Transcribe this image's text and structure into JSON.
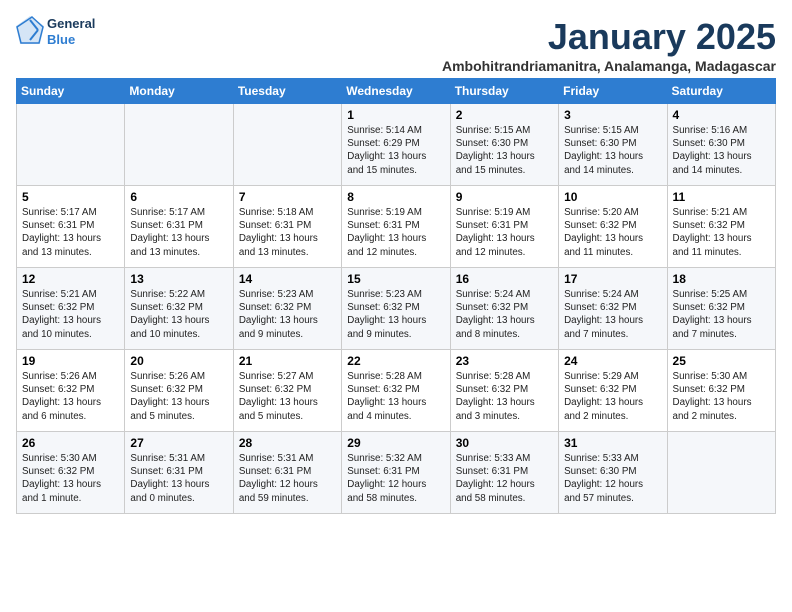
{
  "header": {
    "logo_line1": "General",
    "logo_line2": "Blue",
    "month_year": "January 2025",
    "location": "Ambohitrandriamanitra, Analamanga, Madagascar"
  },
  "days_of_week": [
    "Sunday",
    "Monday",
    "Tuesday",
    "Wednesday",
    "Thursday",
    "Friday",
    "Saturday"
  ],
  "weeks": [
    [
      {
        "day": "",
        "info": ""
      },
      {
        "day": "",
        "info": ""
      },
      {
        "day": "",
        "info": ""
      },
      {
        "day": "1",
        "info": "Sunrise: 5:14 AM\nSunset: 6:29 PM\nDaylight: 13 hours\nand 15 minutes."
      },
      {
        "day": "2",
        "info": "Sunrise: 5:15 AM\nSunset: 6:30 PM\nDaylight: 13 hours\nand 15 minutes."
      },
      {
        "day": "3",
        "info": "Sunrise: 5:15 AM\nSunset: 6:30 PM\nDaylight: 13 hours\nand 14 minutes."
      },
      {
        "day": "4",
        "info": "Sunrise: 5:16 AM\nSunset: 6:30 PM\nDaylight: 13 hours\nand 14 minutes."
      }
    ],
    [
      {
        "day": "5",
        "info": "Sunrise: 5:17 AM\nSunset: 6:31 PM\nDaylight: 13 hours\nand 13 minutes."
      },
      {
        "day": "6",
        "info": "Sunrise: 5:17 AM\nSunset: 6:31 PM\nDaylight: 13 hours\nand 13 minutes."
      },
      {
        "day": "7",
        "info": "Sunrise: 5:18 AM\nSunset: 6:31 PM\nDaylight: 13 hours\nand 13 minutes."
      },
      {
        "day": "8",
        "info": "Sunrise: 5:19 AM\nSunset: 6:31 PM\nDaylight: 13 hours\nand 12 minutes."
      },
      {
        "day": "9",
        "info": "Sunrise: 5:19 AM\nSunset: 6:31 PM\nDaylight: 13 hours\nand 12 minutes."
      },
      {
        "day": "10",
        "info": "Sunrise: 5:20 AM\nSunset: 6:32 PM\nDaylight: 13 hours\nand 11 minutes."
      },
      {
        "day": "11",
        "info": "Sunrise: 5:21 AM\nSunset: 6:32 PM\nDaylight: 13 hours\nand 11 minutes."
      }
    ],
    [
      {
        "day": "12",
        "info": "Sunrise: 5:21 AM\nSunset: 6:32 PM\nDaylight: 13 hours\nand 10 minutes."
      },
      {
        "day": "13",
        "info": "Sunrise: 5:22 AM\nSunset: 6:32 PM\nDaylight: 13 hours\nand 10 minutes."
      },
      {
        "day": "14",
        "info": "Sunrise: 5:23 AM\nSunset: 6:32 PM\nDaylight: 13 hours\nand 9 minutes."
      },
      {
        "day": "15",
        "info": "Sunrise: 5:23 AM\nSunset: 6:32 PM\nDaylight: 13 hours\nand 9 minutes."
      },
      {
        "day": "16",
        "info": "Sunrise: 5:24 AM\nSunset: 6:32 PM\nDaylight: 13 hours\nand 8 minutes."
      },
      {
        "day": "17",
        "info": "Sunrise: 5:24 AM\nSunset: 6:32 PM\nDaylight: 13 hours\nand 7 minutes."
      },
      {
        "day": "18",
        "info": "Sunrise: 5:25 AM\nSunset: 6:32 PM\nDaylight: 13 hours\nand 7 minutes."
      }
    ],
    [
      {
        "day": "19",
        "info": "Sunrise: 5:26 AM\nSunset: 6:32 PM\nDaylight: 13 hours\nand 6 minutes."
      },
      {
        "day": "20",
        "info": "Sunrise: 5:26 AM\nSunset: 6:32 PM\nDaylight: 13 hours\nand 5 minutes."
      },
      {
        "day": "21",
        "info": "Sunrise: 5:27 AM\nSunset: 6:32 PM\nDaylight: 13 hours\nand 5 minutes."
      },
      {
        "day": "22",
        "info": "Sunrise: 5:28 AM\nSunset: 6:32 PM\nDaylight: 13 hours\nand 4 minutes."
      },
      {
        "day": "23",
        "info": "Sunrise: 5:28 AM\nSunset: 6:32 PM\nDaylight: 13 hours\nand 3 minutes."
      },
      {
        "day": "24",
        "info": "Sunrise: 5:29 AM\nSunset: 6:32 PM\nDaylight: 13 hours\nand 2 minutes."
      },
      {
        "day": "25",
        "info": "Sunrise: 5:30 AM\nSunset: 6:32 PM\nDaylight: 13 hours\nand 2 minutes."
      }
    ],
    [
      {
        "day": "26",
        "info": "Sunrise: 5:30 AM\nSunset: 6:32 PM\nDaylight: 13 hours\nand 1 minute."
      },
      {
        "day": "27",
        "info": "Sunrise: 5:31 AM\nSunset: 6:31 PM\nDaylight: 13 hours\nand 0 minutes."
      },
      {
        "day": "28",
        "info": "Sunrise: 5:31 AM\nSunset: 6:31 PM\nDaylight: 12 hours\nand 59 minutes."
      },
      {
        "day": "29",
        "info": "Sunrise: 5:32 AM\nSunset: 6:31 PM\nDaylight: 12 hours\nand 58 minutes."
      },
      {
        "day": "30",
        "info": "Sunrise: 5:33 AM\nSunset: 6:31 PM\nDaylight: 12 hours\nand 58 minutes."
      },
      {
        "day": "31",
        "info": "Sunrise: 5:33 AM\nSunset: 6:30 PM\nDaylight: 12 hours\nand 57 minutes."
      },
      {
        "day": "",
        "info": ""
      }
    ]
  ]
}
